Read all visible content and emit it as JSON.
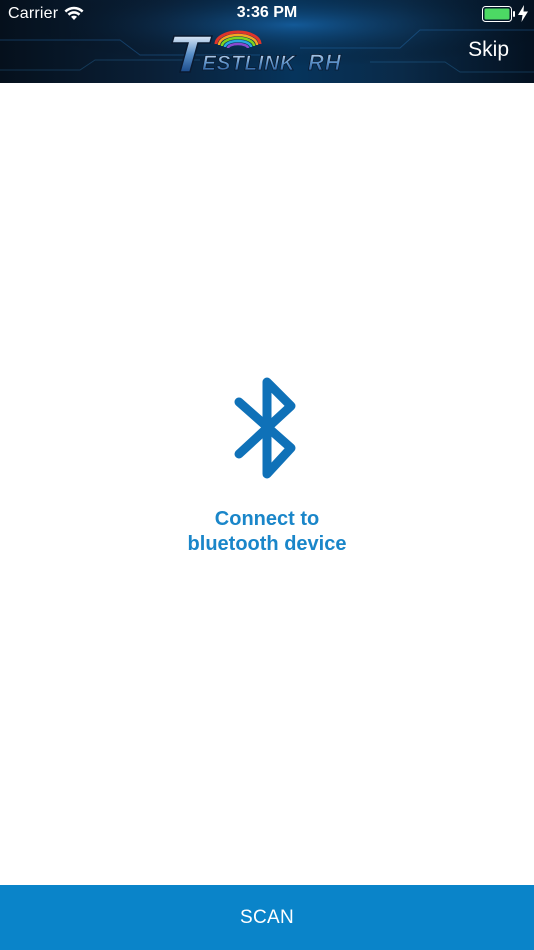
{
  "status_bar": {
    "carrier": "Carrier",
    "time": "3:36 PM",
    "wifi_icon": "wifi-icon",
    "battery_icon": "battery-charging-icon"
  },
  "nav_bar": {
    "logo_text": "TESTLINK RH",
    "skip_label": "Skip"
  },
  "main": {
    "icon": "bluetooth-icon",
    "connect_line1": "Connect to",
    "connect_line2": "bluetooth device"
  },
  "footer": {
    "scan_label": "SCAN"
  },
  "colors": {
    "accent": "#0a84c9",
    "text_accent": "#1a86c9",
    "battery": "#4cd964",
    "header_dark": "#05101c"
  }
}
